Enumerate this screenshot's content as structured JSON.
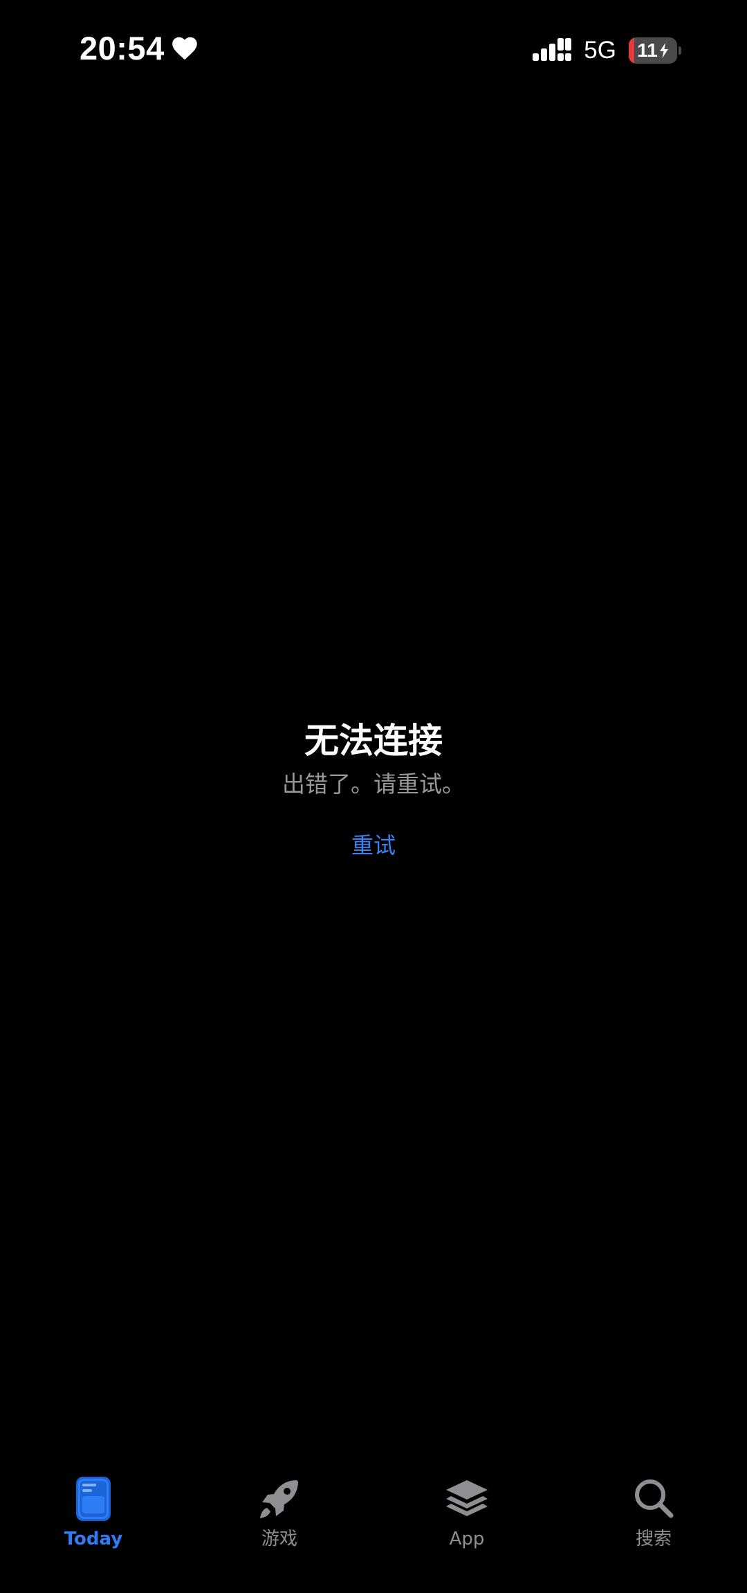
{
  "status_bar": {
    "time": "20:54",
    "network": "5G",
    "battery_level": "11",
    "battery_fraction": 0.11,
    "battery_color": "#e5393b"
  },
  "message": {
    "title": "无法连接",
    "subtitle": "出错了。请重试。",
    "retry_label": "重试",
    "retry_color": "#3b82f6"
  },
  "tab_bar": {
    "active_color": "#2f7df6",
    "inactive_color": "#8e8e93",
    "tabs": [
      {
        "label": "Today",
        "icon": "today-icon",
        "active": true
      },
      {
        "label": "游戏",
        "icon": "rocket-icon",
        "active": false
      },
      {
        "label": "App",
        "icon": "app-stack-icon",
        "active": false
      },
      {
        "label": "搜索",
        "icon": "search-icon",
        "active": false
      }
    ]
  }
}
